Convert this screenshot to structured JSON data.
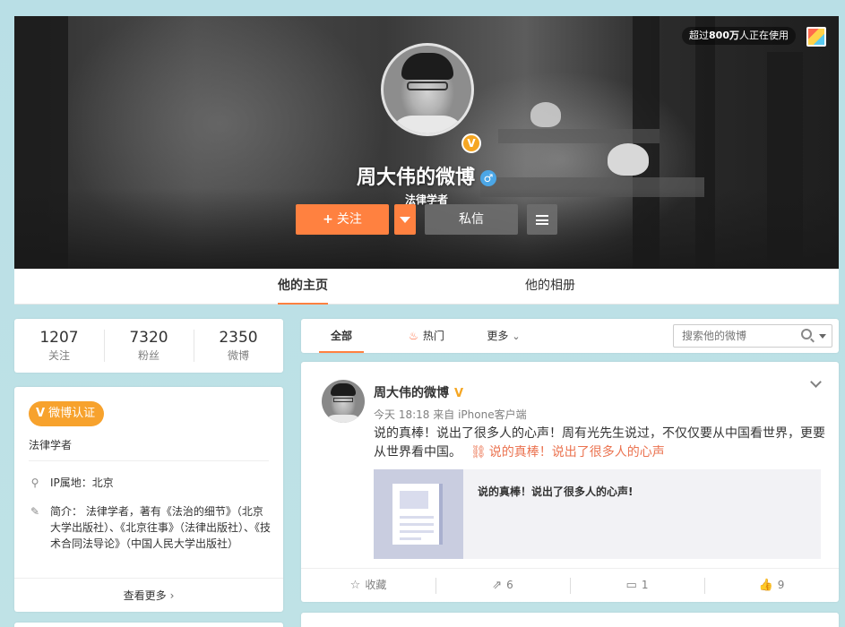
{
  "cover": {
    "users_badge_prefix": "超过",
    "users_badge_count": "800万",
    "users_badge_suffix": "人正在使用"
  },
  "profile": {
    "name": "周大伟的微博",
    "verified_mark": "V",
    "gender_icon": "♂",
    "description": "法律学者",
    "follow_label": "关注",
    "follow_plus": "+",
    "message_label": "私信"
  },
  "tabs": [
    {
      "label": "他的主页",
      "active": true
    },
    {
      "label": "他的相册",
      "active": false
    }
  ],
  "stats": [
    {
      "value": "1207",
      "label": "关注"
    },
    {
      "value": "7320",
      "label": "粉丝"
    },
    {
      "value": "2350",
      "label": "微博"
    }
  ],
  "info": {
    "verify_tag": "微博认证",
    "verify_mark": "V",
    "verify_desc": "法律学者",
    "ip": "IP属地：北京",
    "intro": "简介：  法律学者，著有《法治的细节》（北京大学出版社）、《北京往事》（法律出版社）、《技术合同法导论》（中国人民大学出版社）",
    "see_more": "查看更多",
    "see_more_chevron": "›"
  },
  "feed_filter": {
    "all": "全部",
    "hot": "热门",
    "more": "更多",
    "search_placeholder": "搜索他的微博"
  },
  "post": {
    "author": "周大伟的微博",
    "verified_mark": "V",
    "time": "今天 18:18",
    "source_prefix": "来自",
    "source": "iPhone客户端",
    "text": "说的真棒！说出了很多人的心声！周有光先生说过，不仅仅要从中国看世界，更要从世界看中国。",
    "link_text": "说的真棒！说出了很多人的心声",
    "card_title": "说的真棒！说出了很多人的心声!",
    "actions": {
      "favorite": "收藏",
      "repost": "6",
      "comment": "1",
      "like": "9"
    }
  },
  "colors": {
    "accent": "#ff8140",
    "link": "#eb7350",
    "verified": "#f5a623",
    "page_bg": "#bfe2e6"
  }
}
